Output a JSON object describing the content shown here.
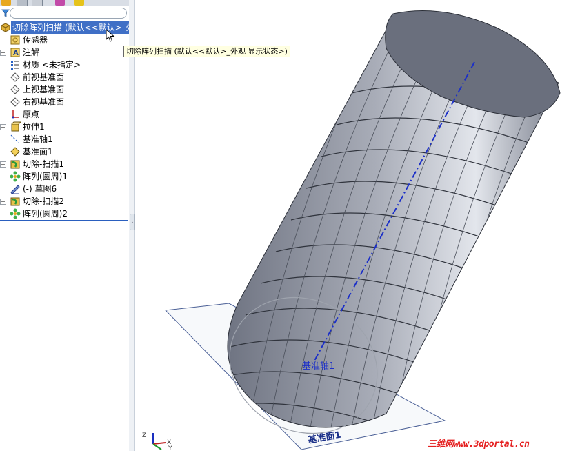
{
  "feature_tree": {
    "root_label": "切除阵列扫描  (默认<<默认>_外",
    "items": [
      {
        "label": "传感器",
        "icon": "sensor-icon",
        "expandable": false
      },
      {
        "label": "注解",
        "icon": "annotation-icon",
        "expandable": true
      },
      {
        "label": "材质 <未指定>",
        "icon": "material-icon",
        "expandable": false
      },
      {
        "label": "前视基准面",
        "icon": "plane-icon",
        "expandable": false
      },
      {
        "label": "上视基准面",
        "icon": "plane-icon",
        "expandable": false
      },
      {
        "label": "右视基准面",
        "icon": "plane-icon",
        "expandable": false
      },
      {
        "label": "原点",
        "icon": "origin-icon",
        "expandable": false
      },
      {
        "label": "拉伸1",
        "icon": "extrude-icon",
        "expandable": true
      },
      {
        "label": "基准轴1",
        "icon": "axis-icon",
        "expandable": false
      },
      {
        "label": "基准面1",
        "icon": "plane-yellow-icon",
        "expandable": false
      },
      {
        "label": "切除-扫描1",
        "icon": "cut-sweep-icon",
        "expandable": true
      },
      {
        "label": "阵列(圆周)1",
        "icon": "circular-pattern-icon",
        "expandable": false
      },
      {
        "label": "(-) 草图6",
        "icon": "sketch-icon",
        "expandable": false
      },
      {
        "label": "切除-扫描2",
        "icon": "cut-sweep-icon",
        "expandable": true
      },
      {
        "label": "阵列(圆周)2",
        "icon": "circular-pattern-icon",
        "expandable": false
      }
    ]
  },
  "tooltip": "切除阵列扫描  (默认<<默认>_外观 显示状态>)",
  "viewport": {
    "axis_label": "基准轴1",
    "plane_label": "基准面1",
    "triad_labels": {
      "z": "Z",
      "x": "X",
      "y": "Y"
    },
    "watermark": "三维网www.3dportal.cn"
  },
  "colors": {
    "selection": "#3f6fc6",
    "axis_blue": "#1b2fc8",
    "part_gray": "#8a8f9c",
    "watermark_red": "#e52121"
  }
}
